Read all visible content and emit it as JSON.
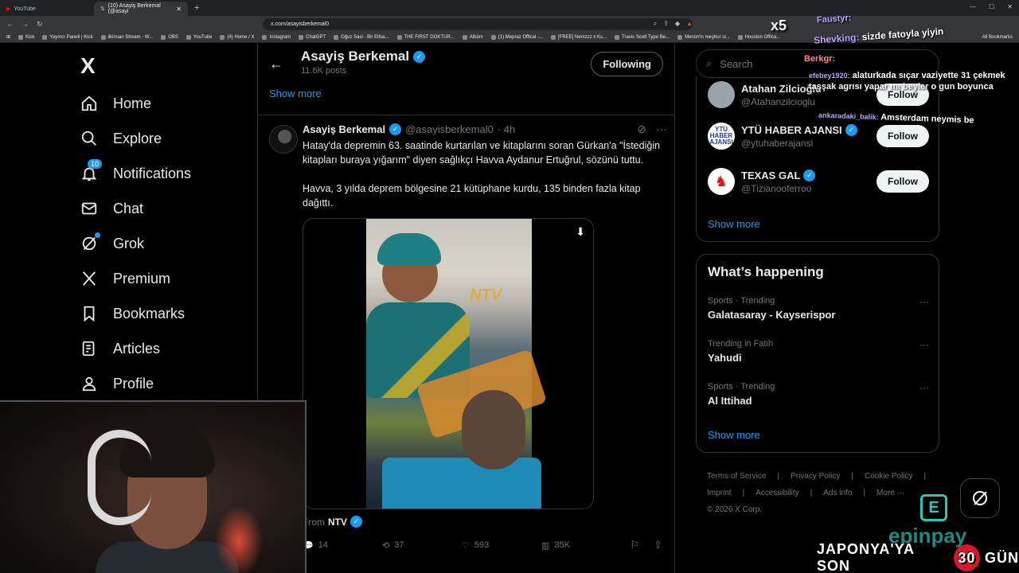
{
  "browser": {
    "tabs": [
      {
        "label": "YouTube"
      },
      {
        "label": "(10) Asayiş Berkemal (@asayi"
      },
      {
        "label": "+"
      }
    ],
    "url": "x.com/asayisberkemal0",
    "bookmarks": [
      "Kick",
      "Yayıncı Paneli | Kick",
      "ilkinsan Stream - W...",
      "OBS",
      "YouTube",
      "(4) Home / X",
      "Instagram",
      "ChatGPT",
      "Oğuz Sasi - Bir Elfsa...",
      "THE FIRST GOKTUR...",
      "Albüm",
      "(1) Mepraz Offical -...",
      "[FREE] Nemzzz x Ks...",
      "Travis Scott Type Be...",
      "Mersin'in meşhur ci...",
      "Houston Offica..."
    ],
    "all_bookmarks": "All Bookmarks"
  },
  "sidebar": {
    "logo": "X",
    "items": [
      {
        "label": "Home",
        "icon": "home-icon"
      },
      {
        "label": "Explore",
        "icon": "search-icon"
      },
      {
        "label": "Notifications",
        "icon": "bell-icon",
        "badge": "10"
      },
      {
        "label": "Chat",
        "icon": "mail-icon"
      },
      {
        "label": "Grok",
        "icon": "grok-icon"
      },
      {
        "label": "Premium",
        "icon": "x-premium-icon"
      },
      {
        "label": "Bookmarks",
        "icon": "bookmark-icon"
      },
      {
        "label": "Articles",
        "icon": "article-icon"
      },
      {
        "label": "Profile",
        "icon": "person-icon"
      }
    ]
  },
  "header": {
    "name": "Asayiş Berkemal",
    "posts": "11.6K posts",
    "following_label": "Following",
    "show_more": "Show more"
  },
  "tweet": {
    "name": "Asayiş Berkemal",
    "handle": "@asayisberkemal0",
    "time": "· 4h",
    "text": "Hatay'da depremin 63. saatinde kurtarılan ve kitaplarını soran Gürkan'a \"İstediğin kitapları buraya yığarım\" diyen sağlıkçı Havva Aydanur Ertuğrul, sözünü tuttu.\n\nHavva, 3 yılda deprem bölgesine 21 kütüphane kurdu, 135 binden fazla kitap dağıttı.",
    "media_watermark": "NTV",
    "from_label": "From",
    "from_source": "NTV",
    "replies": "14",
    "reposts": "37",
    "likes": "593",
    "views": "35K"
  },
  "search": {
    "placeholder": "Search"
  },
  "who_to_follow": {
    "accounts": [
      {
        "name": "Atahan Zilcioğlu",
        "handle": "@Atahanzilcioglu",
        "button": "Follow"
      },
      {
        "name": "YTÜ HABER AJANSI",
        "handle": "@ytuhaberajansi",
        "button": "Follow",
        "avatar_text": "YTÜ HABER AJANSI"
      },
      {
        "name": "TEXAS GAL",
        "handle": "@Tizianooferroo",
        "button": "Follow"
      }
    ],
    "show_more": "Show more"
  },
  "happening": {
    "title": "What’s happening",
    "trends": [
      {
        "context": "Sports · Trending",
        "name": "Galatasaray - Kayserispor"
      },
      {
        "context": "Trending in Fatih",
        "name": "Yahudi"
      },
      {
        "context": "Sports · Trending",
        "name": "Al Ittihad"
      }
    ],
    "show_more": "Show more"
  },
  "footer": {
    "links": [
      "Terms of Service",
      "|",
      "Privacy Policy",
      "|",
      "Cookie Policy",
      "|",
      "Imprint",
      "|",
      "Accessibility",
      "|",
      "Ads info",
      "|",
      "More ···"
    ],
    "copyright": "© 2026 X Corp."
  },
  "stream_overlay": {
    "chat": [
      {
        "user": "Faustyr:",
        "text": "",
        "emote": "x5"
      },
      {
        "user": "Shevking:",
        "text": "sizde fatoyla yiyin"
      },
      {
        "user": "Berkgr:",
        "text": ""
      },
      {
        "user": "efebey1920:",
        "text": "alaturkada sıçar vaziyette 31 çekmek taşşak agrısı yapar mı beyler o gun boyunca"
      },
      {
        "user": "ankaradaki_balik:",
        "text": "Amsterdam neymis be"
      }
    ],
    "sponsor": "epinpay",
    "countdown_prefix": "JAPONYA'YA SON",
    "countdown_value": "30",
    "countdown_suffix": "GÜN"
  },
  "colors": {
    "accent": "#1d9bf0",
    "background": "#000000",
    "text": "#e7e9ea",
    "muted": "#71767b",
    "border": "#2f3336"
  }
}
